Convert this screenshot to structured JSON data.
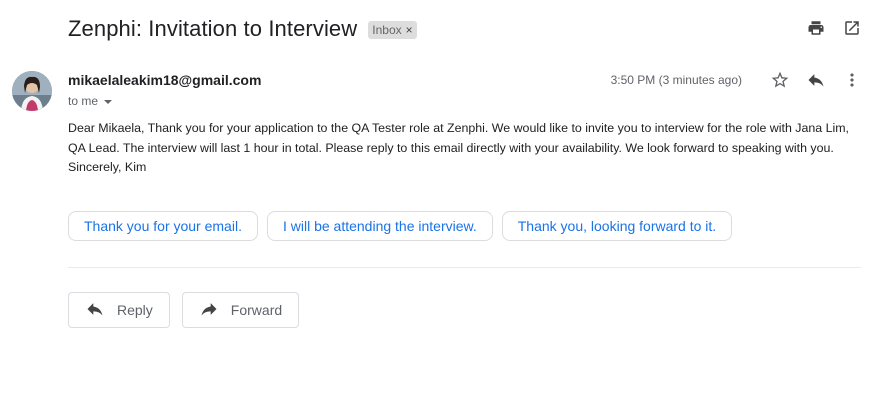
{
  "email": {
    "subject": "Zenphi: Invitation to Interview",
    "label": "Inbox",
    "label_remove": "×",
    "sender": "mikaelaleakim18@gmail.com",
    "recipient": "to me",
    "time": "3:50 PM (3 minutes ago)",
    "body": "Dear Mikaela, Thank you for your application to the QA Tester role at Zenphi. We would like to invite you to interview for the role with Jana Lim, QA Lead. The interview will last 1 hour in total. Please reply to this email directly with your availability. We look forward to speaking with you. Sincerely, Kim"
  },
  "smart_replies": [
    "Thank you for your email.",
    "I will be attending the interview.",
    "Thank you, looking forward to it."
  ],
  "actions": {
    "reply": "Reply",
    "forward": "Forward"
  },
  "icons": {
    "print": "print-icon",
    "open_new_window": "open-in-new-window-icon",
    "star": "star-icon",
    "reply": "reply-icon",
    "more": "more-vertical-icon",
    "forward": "forward-icon"
  },
  "colors": {
    "accent": "#1a73e8",
    "text": "#202124",
    "secondary": "#5f6368"
  }
}
